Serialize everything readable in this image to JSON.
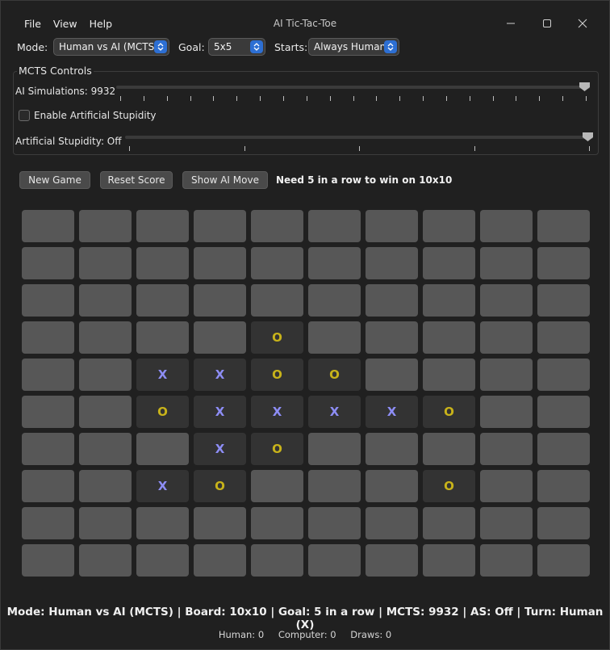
{
  "window": {
    "title": "AI Tic-Tac-Toe"
  },
  "menu": [
    "File",
    "View",
    "Help"
  ],
  "controls": {
    "mode_label": "Mode:",
    "mode_value": "Human vs AI (MCTS)",
    "goal_label": "Goal:",
    "goal_value": "5x5",
    "starts_label": "Starts:",
    "starts_value": "Always Human"
  },
  "mcts": {
    "group_title": "MCTS Controls",
    "simulations_label": "AI Simulations: 9932",
    "simulations_fraction": 1.0,
    "stupidity_checkbox_label": "Enable Artificial Stupidity",
    "stupidity_checked": false,
    "stupidity_label": "Artificial Stupidity: Off",
    "stupidity_fraction": 1.0
  },
  "actions": {
    "new_game": "New Game",
    "reset_score": "Reset Score",
    "show_ai_move": "Show AI Move",
    "hint": "Need 5 in a row to win on 10x10"
  },
  "board": {
    "size": 10,
    "rows": [
      "..........",
      "..........",
      "..........",
      "....O.....",
      "..XXOO....",
      "..OXXXXO..",
      "...XO.....",
      "..XO...O..",
      "..........",
      ".........."
    ]
  },
  "status": {
    "line": "Mode: Human vs AI (MCTS) | Board: 10x10 | Goal: 5 in a row | MCTS: 9932 | AS: Off | Turn: Human (X)",
    "human": "Human: 0",
    "computer": "Computer: 0",
    "draws": "Draws: 0"
  },
  "colors": {
    "x": "#8d8df5",
    "o": "#c8b31a",
    "accent": "#2d6fd3"
  }
}
